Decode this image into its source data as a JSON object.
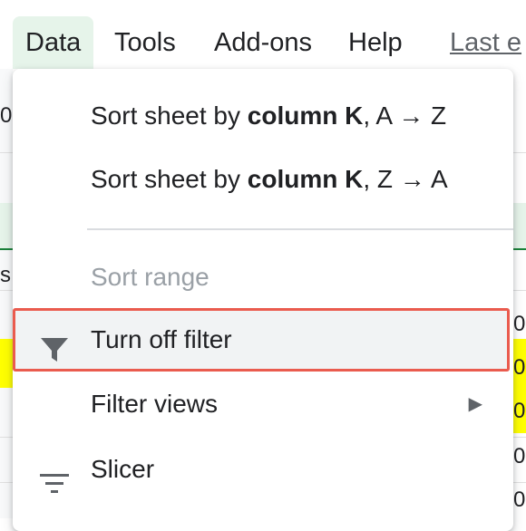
{
  "menubar": {
    "items": [
      {
        "label": "Data"
      },
      {
        "label": "Tools"
      },
      {
        "label": "Add-ons"
      },
      {
        "label": "Help"
      }
    ],
    "last_edit_link": "Last e"
  },
  "sheet": {
    "left_fragments": [
      "0",
      "s"
    ],
    "right_fragments": [
      "0",
      "0",
      "0",
      "0",
      "0"
    ]
  },
  "dropdown": {
    "sort_az": {
      "prefix": "Sort sheet by ",
      "bold": "column K",
      "suffix": ", A → Z"
    },
    "sort_za": {
      "prefix": "Sort sheet by ",
      "bold": "column K",
      "suffix": ", Z → A"
    },
    "sort_range": "Sort range",
    "turn_off_filter": "Turn off filter",
    "filter_views": "Filter views",
    "slicer": "Slicer",
    "submenu_arrow": "▶"
  },
  "colors": {
    "active_menu_bg": "#e6f4ea",
    "highlight_border": "#ea5b4e",
    "highlight_row": "#ffff00"
  },
  "icons": {
    "filter": "filter-icon",
    "slicer": "slicer-icon",
    "submenu": "chevron-right-icon"
  }
}
